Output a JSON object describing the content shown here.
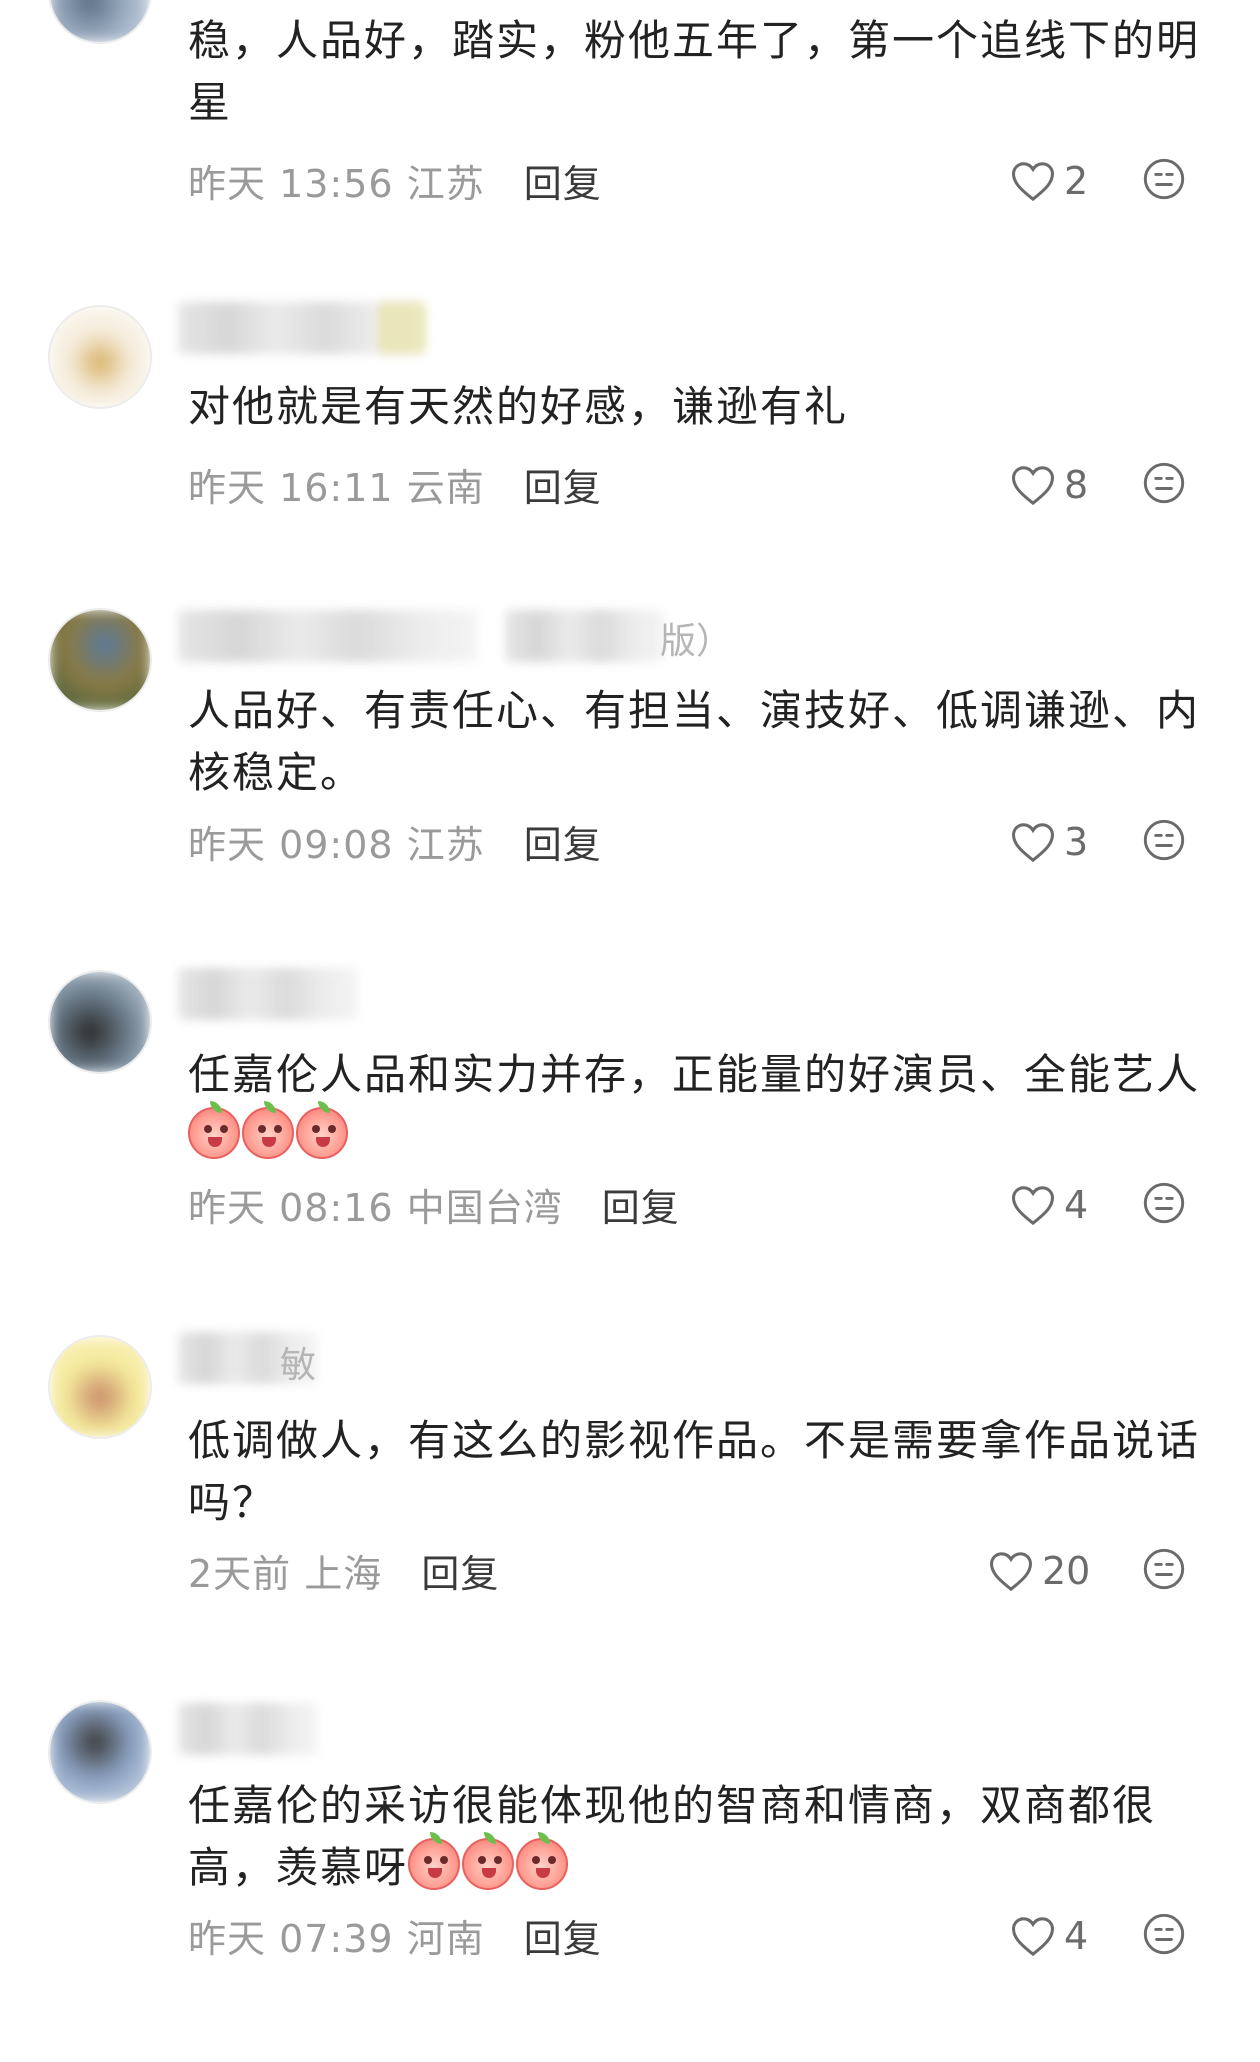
{
  "comments": [
    {
      "text": "稳，人品好，踏实，粉他五年了，第一个追线下的明星",
      "time": "昨天 13:56",
      "location": "江苏",
      "reply_label": "回复",
      "likes": "2",
      "emoji_count": 0
    },
    {
      "text": "对他就是有天然的好感，谦逊有礼",
      "time": "昨天 16:11",
      "location": "云南",
      "reply_label": "回复",
      "likes": "8",
      "emoji_count": 0
    },
    {
      "name_visible": "版）",
      "text": "人品好、有责任心、有担当、演技好、低调谦逊、内核稳定。",
      "time": "昨天 09:08",
      "location": "江苏",
      "reply_label": "回复",
      "likes": "3",
      "emoji_count": 0
    },
    {
      "text": "任嘉伦人品和实力并存，正能量的好演员、全能艺人",
      "time": "昨天 08:16",
      "location": "中国台湾",
      "reply_label": "回复",
      "likes": "4",
      "emoji_count": 3
    },
    {
      "name_visible": "敏",
      "text": "低调做人，有这么的影视作品。不是需要拿作品说话吗？",
      "time": "2天前",
      "location": "上海",
      "reply_label": "回复",
      "likes": "20",
      "emoji_count": 0
    },
    {
      "text": "任嘉伦的采访很能体现他的智商和情商，双商都很高，羡慕呀",
      "time": "昨天 07:39",
      "location": "河南",
      "reply_label": "回复",
      "likes": "4",
      "emoji_count": 3
    }
  ],
  "icons": {
    "like": "heart-outline-icon",
    "reaction": "neutral-face-icon"
  },
  "colors": {
    "text": "#222222",
    "meta": "#9a9a9a",
    "reply": "#3a3a3a"
  }
}
